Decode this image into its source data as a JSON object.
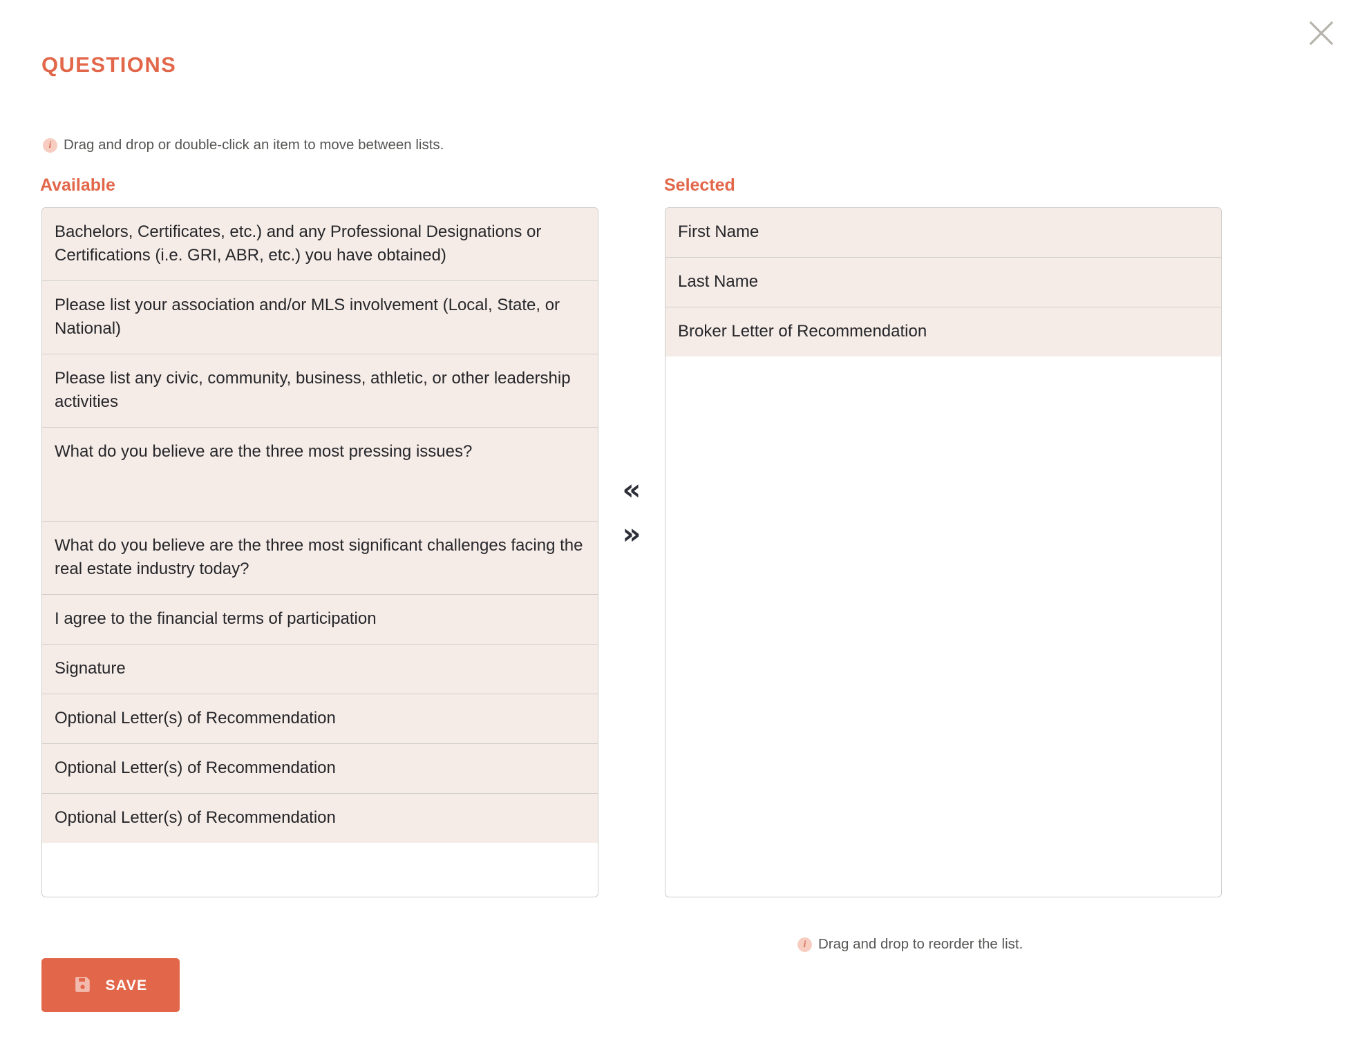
{
  "dialog": {
    "title": "QUESTIONS",
    "close_icon": "close-icon"
  },
  "hints": {
    "top": "Drag and drop or double-click an item to move between lists.",
    "bottom": "Drag and drop to reorder the list.",
    "icon": "info-icon"
  },
  "columns": {
    "available_label": "Available",
    "selected_label": "Selected"
  },
  "available_items": [
    "Bachelors, Certificates, etc.) and any Professional Designations or Certifications (i.e. GRI, ABR, etc.) you have obtained)",
    "Please list your association and/or MLS involvement (Local, State, or National)",
    "Please list any civic, community, business, athletic, or other leadership activities",
    "What do you believe are the three most pressing issues?",
    "What do you believe are the three most significant challenges facing the real estate industry today?",
    "I agree to the financial terms of participation",
    "Signature",
    "Optional Letter(s) of Recommendation",
    "Optional Letter(s) of Recommendation",
    "Optional Letter(s) of Recommendation"
  ],
  "selected_items": [
    "First Name",
    "Last Name",
    "Broker Letter of Recommendation"
  ],
  "transfer": {
    "move_left_label": "«",
    "move_right_label": "»"
  },
  "footer": {
    "save_label": "Save",
    "save_icon": "floppy-disk-icon"
  },
  "colors": {
    "accent": "#e2674a",
    "item_background": "#f5ece7",
    "panel_border": "#cfcdc9",
    "body_text": "#26262a",
    "hint_text": "#555553",
    "info_badge": "#f6cdc0"
  }
}
